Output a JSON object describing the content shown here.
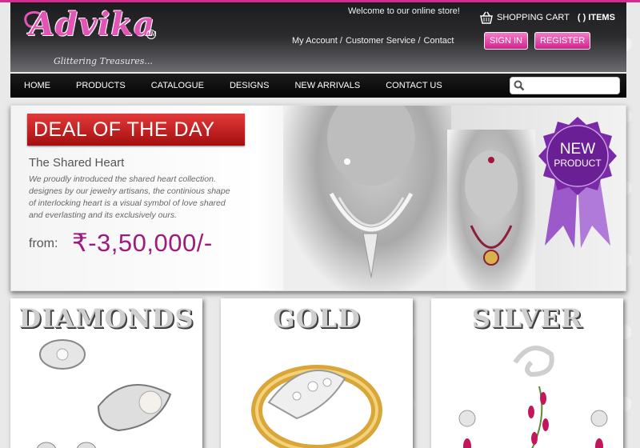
{
  "header": {
    "logo": "Advika",
    "logo_tm": "TM",
    "tagline": "Glittering Treasures...",
    "welcome": "Welcome to our online store!",
    "cart_label": "SHOPPING CART",
    "cart_count": "( ) ITEMS",
    "links": [
      "My Account /",
      "Customer Service /",
      "Contact"
    ],
    "sign_in": "SIGN IN",
    "register": "REGISTER"
  },
  "nav": {
    "items": [
      "HOME",
      "PRODUCTS",
      "CATALOGUE",
      "DESIGNS",
      "NEW ARRIVALS",
      "CONTACT US"
    ],
    "search_placeholder": ""
  },
  "banner": {
    "deal_label": "DEAL OF THE DAY",
    "title": "The Shared Heart",
    "description": "We proudly introduced the shared heart collection. designes by our jewelry artisans, the continious shape of interlocking heart is a visual symbol of love shared and everlasting and its exclusively ours.",
    "from_label": "from:",
    "price": "₹-3,50,000/-",
    "badge_line1": "NEW",
    "badge_line2": "PRODUCT"
  },
  "categories": [
    {
      "title": "Diamonds"
    },
    {
      "title": "Gold"
    },
    {
      "title": "Silver"
    }
  ],
  "colors": {
    "brand_pink": "#d52b8f",
    "deal_red": "#c41f1f",
    "price_purple": "#9e1a7f",
    "badge_purple": "#7a2aa6"
  }
}
